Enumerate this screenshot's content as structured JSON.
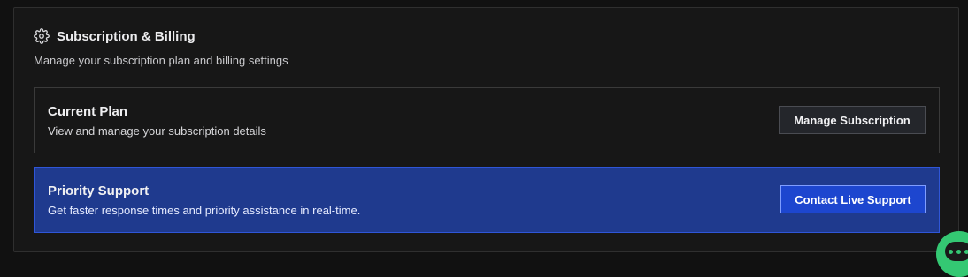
{
  "section": {
    "icon": "gear-icon",
    "title": "Subscription & Billing",
    "subtitle": "Manage your subscription plan and billing settings"
  },
  "current_plan": {
    "title": "Current Plan",
    "description": "View and manage your subscription details",
    "button_label": "Manage Subscription"
  },
  "priority_support": {
    "title": "Priority Support",
    "description": "Get faster response times and priority assistance in real-time.",
    "button_label": "Contact Live Support"
  },
  "chat_widget": {
    "icon": "chat-bubble-icon"
  },
  "colors": {
    "background": "#111111",
    "card": "#171717",
    "support_panel": "#1f3a8e",
    "support_button": "#1d46cf",
    "chat_widget": "#34c873"
  }
}
